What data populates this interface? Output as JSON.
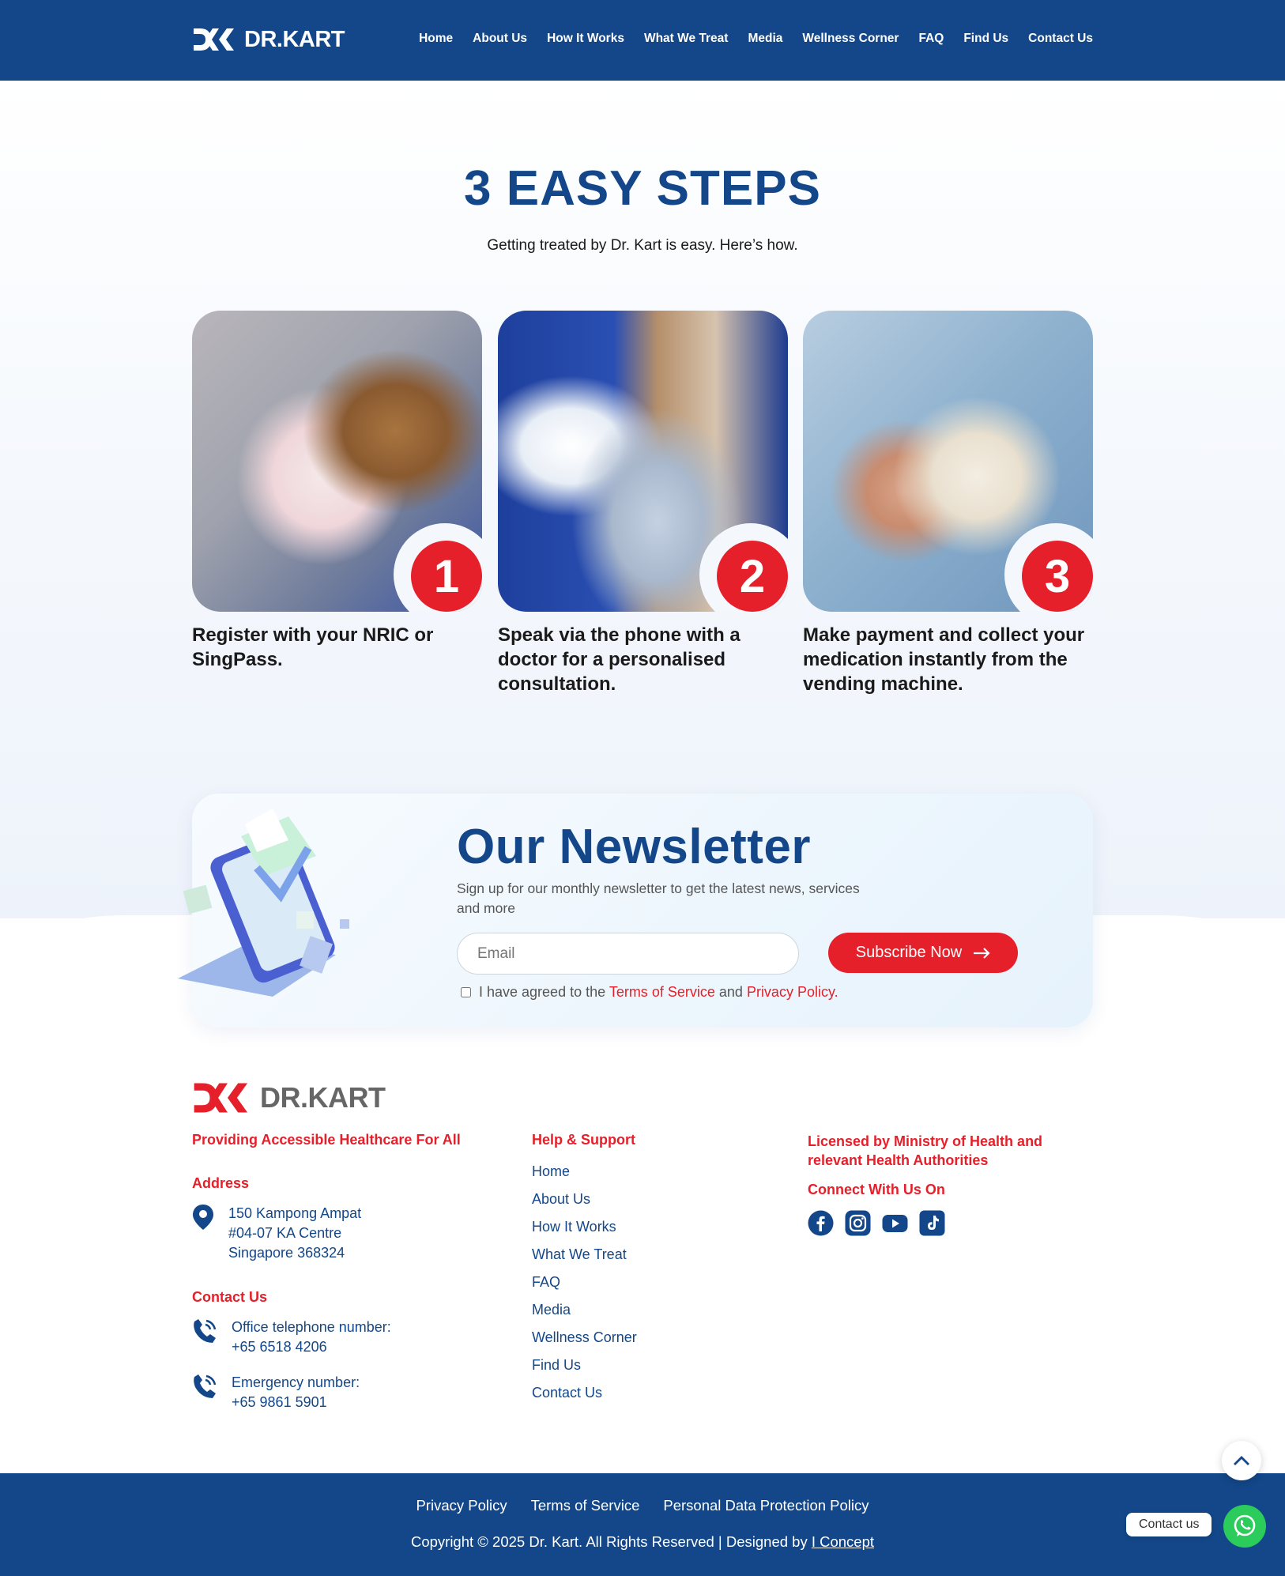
{
  "header": {
    "logo_text": "DR.KART",
    "nav": [
      "Home",
      "About Us",
      "How It Works",
      "What We Treat",
      "Media",
      "Wellness Corner",
      "FAQ",
      "Find Us",
      "Contact Us"
    ]
  },
  "steps": {
    "title": "3 EASY STEPS",
    "subtitle": "Getting treated by Dr. Kart is easy. Here’s how.",
    "items": [
      {
        "num": "1",
        "text": "Register with your NRIC or SingPass."
      },
      {
        "num": "2",
        "text": "Speak via the phone with a doctor for a personalised consultation."
      },
      {
        "num": "3",
        "text": "Make payment and collect your medication instantly from the vending machine."
      }
    ]
  },
  "newsletter": {
    "title": "Our Newsletter",
    "subtitle": "Sign up for our monthly newsletter to get the latest news, services and more",
    "email_placeholder": "Email",
    "button": "Subscribe Now",
    "agree_prefix": "I have agreed to the",
    "terms": "Terms of Service",
    "and": "and",
    "privacy": "Privacy Policy",
    "period": "."
  },
  "footer": {
    "logo_text": "DR.KART",
    "tagline": "Providing Accessible Healthcare For All",
    "address_heading": "Address",
    "address_lines": [
      "150 Kampong Ampat",
      "#04-07 KA Centre",
      "Singapore 368324"
    ],
    "contact_heading": "Contact Us",
    "office_label": "Office telephone number:",
    "office_number": "+65 6518 4206",
    "emergency_label": "Emergency number:",
    "emergency_number": "+65 9861 5901",
    "help_heading": "Help & Support",
    "help_links": [
      "Home",
      "About Us",
      "How It Works",
      "What We Treat",
      "FAQ",
      "Media",
      "Wellness Corner",
      "Find Us",
      "Contact Us"
    ],
    "licensed": "Licensed by Ministry of Health and relevant Health Authorities",
    "connect": "Connect With Us On",
    "social": [
      "facebook-icon",
      "instagram-icon",
      "youtube-icon",
      "tiktok-icon"
    ]
  },
  "bottom": {
    "links": [
      "Privacy Policy",
      "Terms of Service",
      "Personal Data Protection Policy"
    ],
    "copyright": "Copyright © 2025 Dr. Kart. All Rights Reserved | Designed by",
    "designer": "I Concept"
  },
  "floating": {
    "contact_label": "Contact us"
  },
  "colors": {
    "brand_blue": "#134789",
    "brand_red": "#e5202a",
    "whatsapp_green": "#2bcb5c"
  }
}
